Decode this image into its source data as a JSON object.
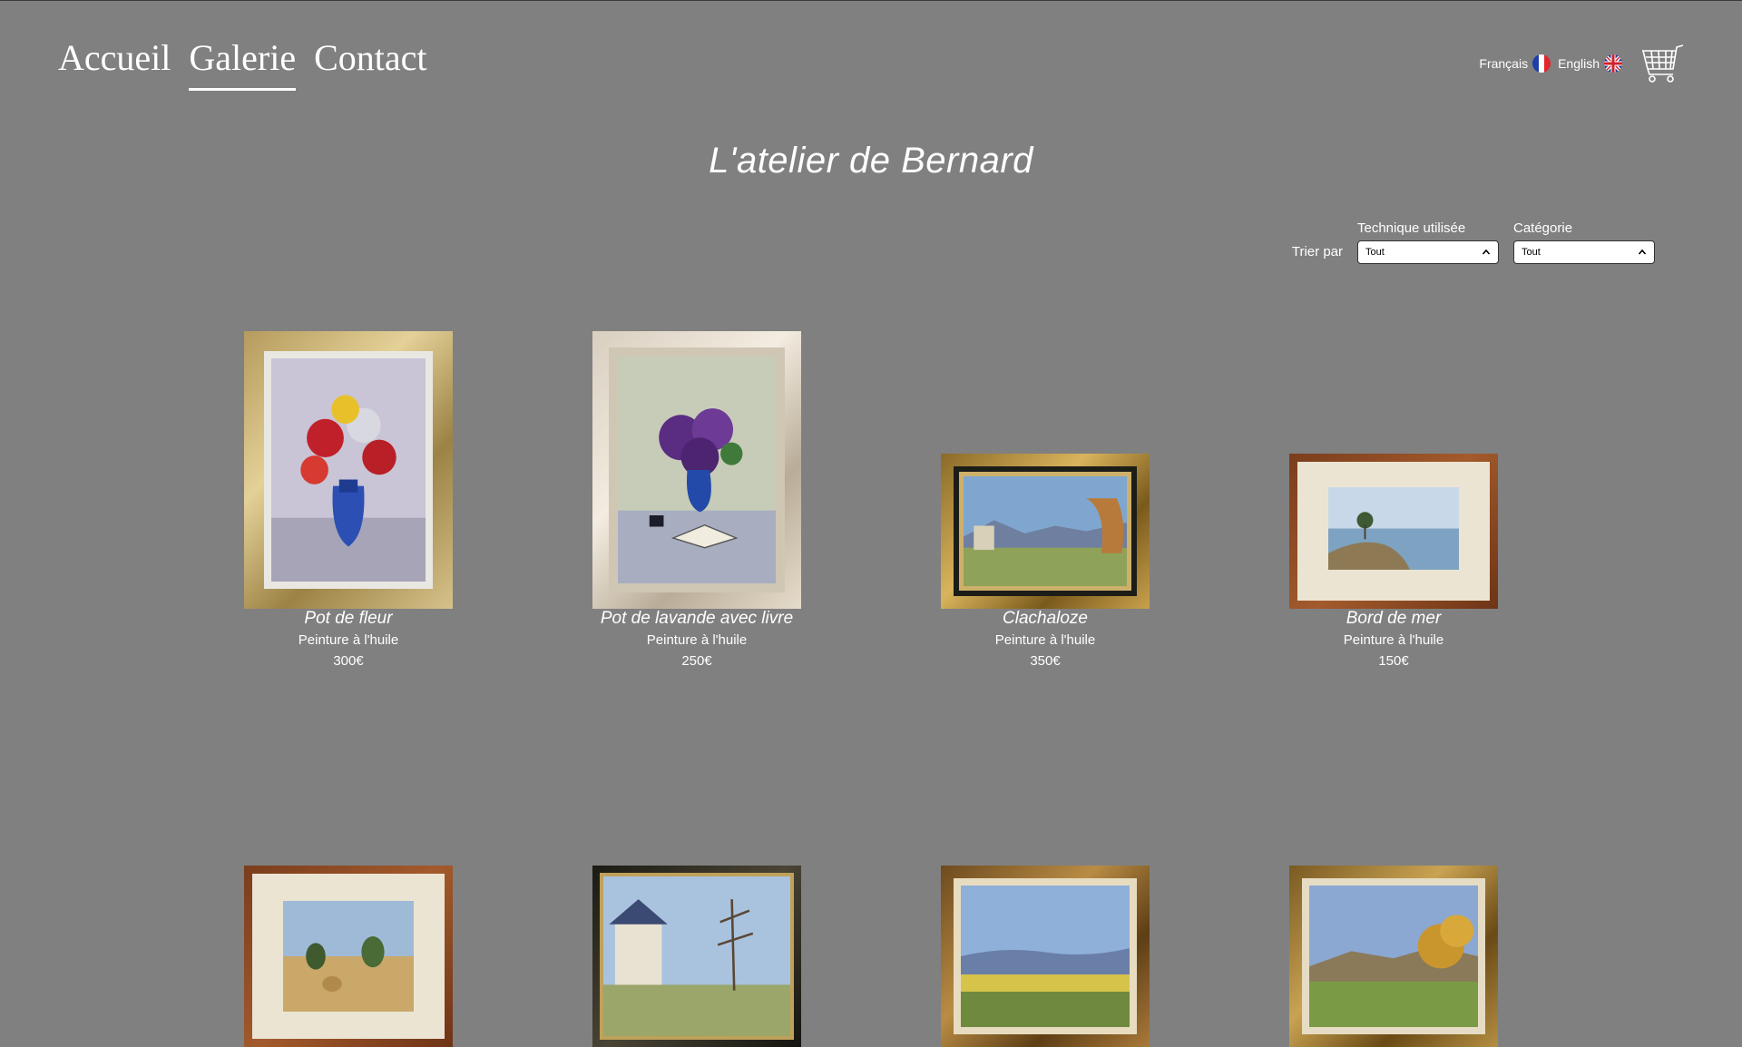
{
  "nav": {
    "items": [
      {
        "label": "Accueil",
        "active": false
      },
      {
        "label": "Galerie",
        "active": true
      },
      {
        "label": "Contact",
        "active": false
      }
    ]
  },
  "languages": [
    {
      "label": "Français",
      "flag": "france-flag-icon"
    },
    {
      "label": "English",
      "flag": "uk-flag-icon"
    }
  ],
  "cart": {
    "icon": "cart-icon"
  },
  "title": "L'atelier de Bernard",
  "filters": {
    "sort_label": "Trier par",
    "technique": {
      "label": "Technique utilisée",
      "value": "Tout"
    },
    "category": {
      "label": "Catégorie",
      "value": "Tout"
    }
  },
  "paintings": [
    {
      "title": "Pot de fleur",
      "technique": "Peinture à l'huile",
      "price": "300€"
    },
    {
      "title": "Pot de lavande avec livre",
      "technique": "Peinture à l'huile",
      "price": "250€"
    },
    {
      "title": "Clachaloze",
      "technique": "Peinture à l'huile",
      "price": "350€"
    },
    {
      "title": "Bord de mer",
      "technique": "Peinture à l'huile",
      "price": "150€"
    }
  ],
  "colors": {
    "background": "#808080",
    "text": "#ffffff"
  }
}
